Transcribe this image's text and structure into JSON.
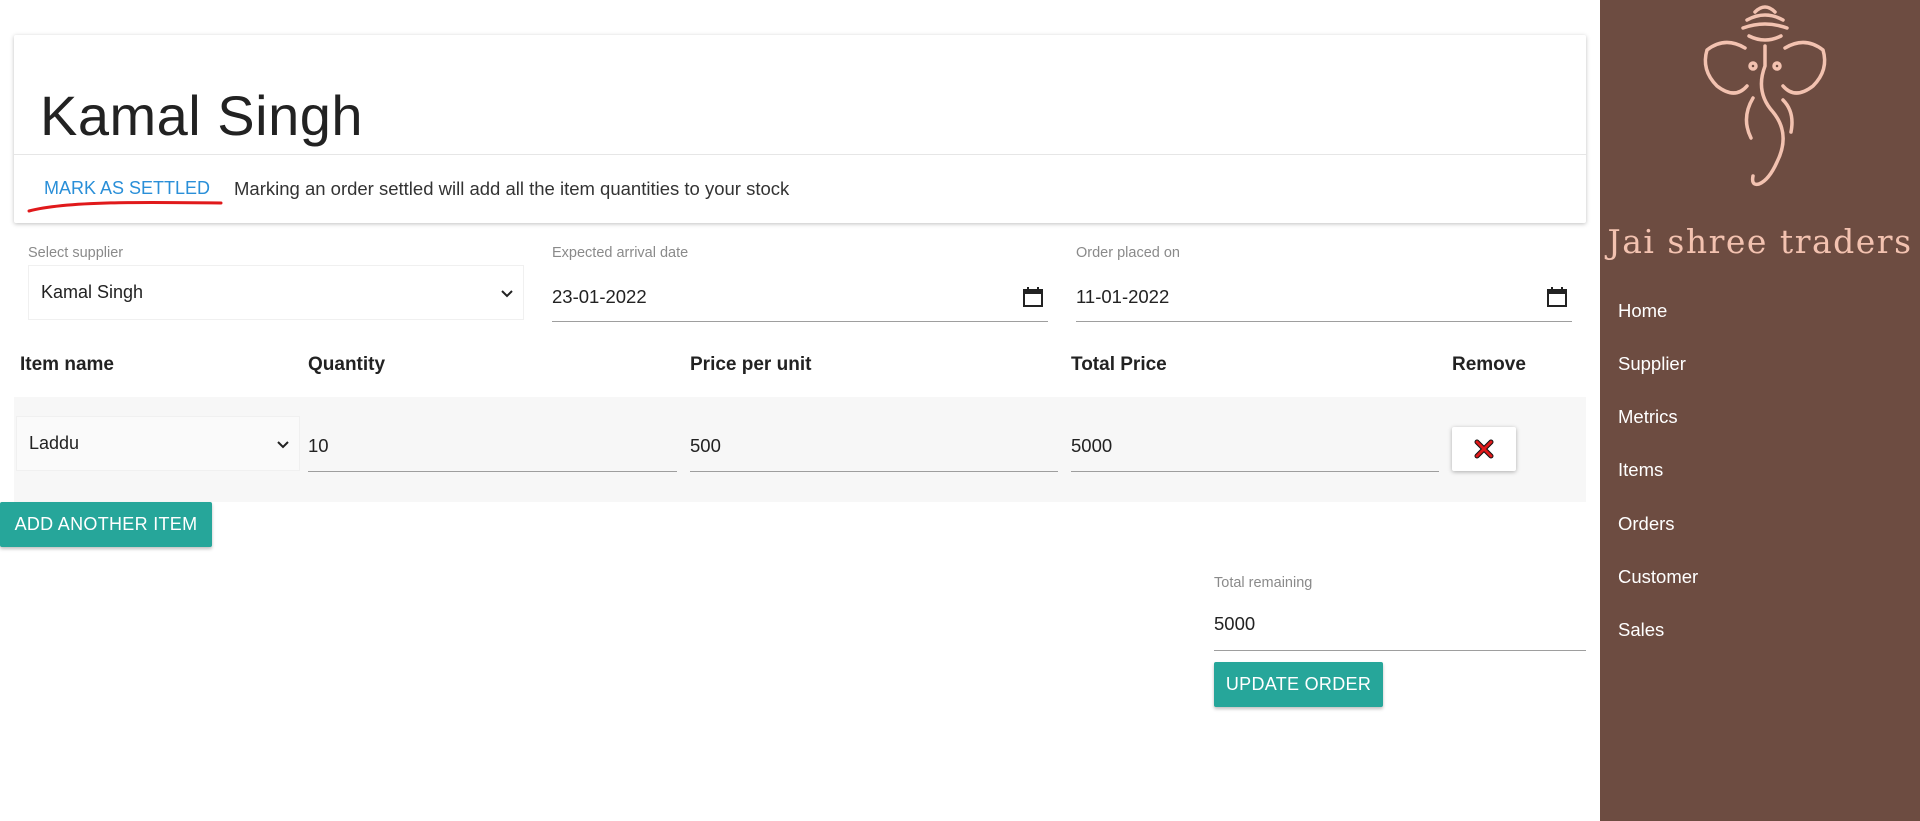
{
  "header": {
    "title": "Kamal Singh",
    "settle_link": "MARK AS SETTLED",
    "settle_description": "Marking an order settled will add all the item quantities to your stock"
  },
  "fields": {
    "supplier_label": "Select supplier",
    "supplier_value": "Kamal Singh",
    "arrival_label": "Expected arrival date",
    "arrival_value": "23-01-2022",
    "placed_label": "Order placed on",
    "placed_value": "11-01-2022"
  },
  "table": {
    "headers": [
      "Item name",
      "Quantity",
      "Price per unit",
      "Total Price",
      "Remove"
    ],
    "rows": [
      {
        "item": "Laddu",
        "quantity": "10",
        "price_per_unit": "500",
        "total_price": "5000"
      }
    ]
  },
  "actions": {
    "add_item": "ADD ANOTHER ITEM",
    "update_order": "UPDATE ORDER"
  },
  "summary": {
    "remaining_label": "Total remaining",
    "remaining_value": "5000"
  },
  "sidebar": {
    "brand": "Jai shree traders",
    "nav": [
      "Home",
      "Supplier",
      "Metrics",
      "Items",
      "Orders",
      "Customer",
      "Sales"
    ]
  },
  "colors": {
    "sidebar_bg": "#6d4c41",
    "accent_teal": "#26a69a",
    "link_blue": "#2a8fd8",
    "annotation_red": "#e0191b",
    "brand_pink": "#f3c2b0"
  },
  "icons": [
    "ganesha-logo-icon",
    "chevron-down-icon",
    "calendar-icon",
    "close-x-icon"
  ]
}
